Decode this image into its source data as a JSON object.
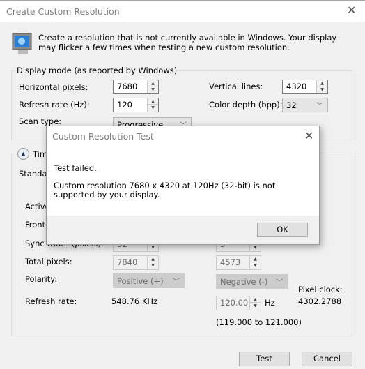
{
  "window": {
    "title": "Create Custom Resolution",
    "intro": "Create a resolution that is not currently available in Windows. Your display may flicker a few times when testing a new custom resolution."
  },
  "display_mode": {
    "group_label": "Display mode (as reported by Windows)",
    "horizontal_label": "Horizontal pixels:",
    "horizontal_value": "7680",
    "vertical_label": "Vertical lines:",
    "vertical_value": "4320",
    "refresh_label": "Refresh rate (Hz):",
    "refresh_value": "120",
    "color_label": "Color depth (bpp):",
    "color_value": "32",
    "scan_label": "Scan type:",
    "scan_value": "Progressive"
  },
  "timing": {
    "group_label": "Timi",
    "standard_label": "Standard",
    "active_label": "Active",
    "front_label": "Front",
    "sync_label": "Sync width (pixels):",
    "sync_h": "32",
    "sync_v": "5",
    "total_label": "Total pixels:",
    "total_h": "7840",
    "total_v": "4573",
    "polarity_label": "Polarity:",
    "polarity_h": "Positive (+)",
    "polarity_v": "Negative (-)",
    "refresh_label": "Refresh rate:",
    "refresh_khz": "548.76 KHz",
    "refresh_hz": "120.000",
    "hz_unit": "Hz",
    "range": "(119.000 to 121.000)",
    "pixel_clock_label": "Pixel clock:",
    "pixel_clock_value": "4302.2788"
  },
  "buttons": {
    "test": "Test",
    "cancel": "Cancel"
  },
  "modal": {
    "title": "Custom Resolution Test",
    "line1": "Test failed.",
    "line2": "Custom resolution 7680 x 4320 at 120Hz (32-bit) is not supported by your display.",
    "ok": "OK"
  }
}
